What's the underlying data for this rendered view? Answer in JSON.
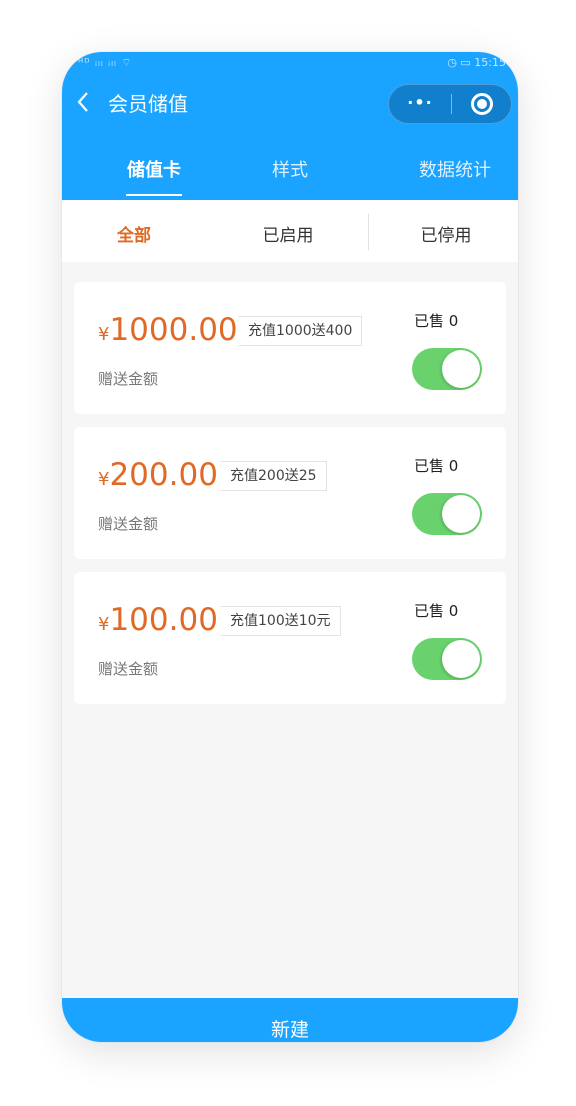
{
  "status_bar": {
    "left": "ᴴᴰ ᵢₗₗ ᵢₗₗ ⌔",
    "right": "◷ ▭ 15:15"
  },
  "nav": {
    "back_icon": "chevron-left",
    "title": "会员储值",
    "more_glyph": "·•·",
    "close_icon": "target-circle"
  },
  "main_tabs": [
    {
      "label": "储值卡",
      "active": true
    },
    {
      "label": "样式",
      "active": false
    },
    {
      "label": "数据统计",
      "active": false
    }
  ],
  "sub_tabs": [
    {
      "label": "全部",
      "active": true
    },
    {
      "label": "已启用",
      "active": false
    },
    {
      "label": "已停用",
      "active": false
    }
  ],
  "cards": [
    {
      "currency": "¥",
      "amount": "1000.00",
      "tag": "充值1000送400",
      "desc": "赠送金额",
      "sold": "已售 0",
      "enabled": true
    },
    {
      "currency": "¥",
      "amount": "200.00",
      "tag": "充值200送25",
      "desc": "赠送金额",
      "sold": "已售 0",
      "enabled": true
    },
    {
      "currency": "¥",
      "amount": "100.00",
      "tag": "充值100送10元",
      "desc": "赠送金额",
      "sold": "已售 0",
      "enabled": true
    }
  ],
  "bottom_button": {
    "label": "新建"
  },
  "colors": {
    "primary": "#1aa3ff",
    "accent": "#e06a25",
    "toggle_on": "#69d26d"
  }
}
